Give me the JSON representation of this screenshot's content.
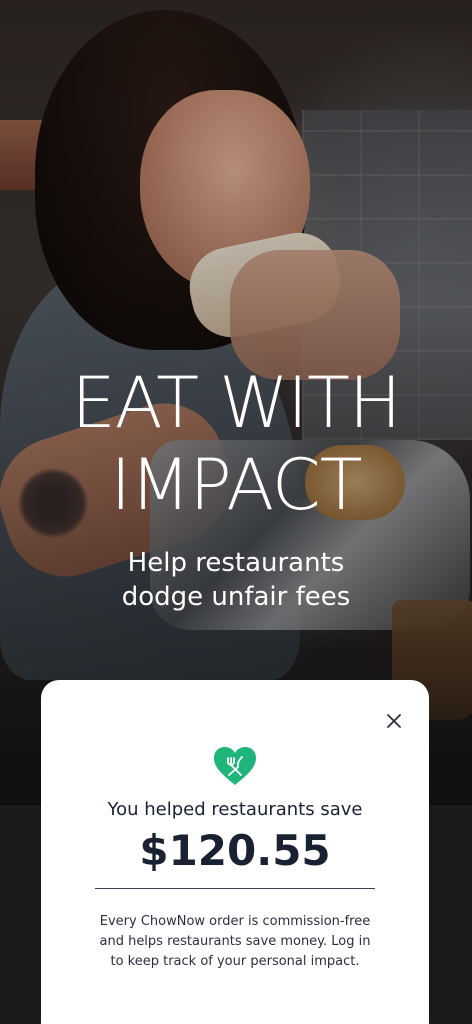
{
  "hero": {
    "headline_line1": "EAT WITH",
    "headline_line2": "IMPACT",
    "subhead_line1": "Help restaurants",
    "subhead_line2": "dodge unfair fees",
    "image": "woman-eating-sandwich-photo"
  },
  "impact_card": {
    "close_icon": "close-icon",
    "heart_icon": "heart-fork-knife-icon",
    "title": "You helped restaurants save",
    "amount": "$120.55",
    "description_line1": "Every ChowNow order is commission-free",
    "description_line2": "and helps restaurants save money. Log in",
    "description_line3": "to keep track of your personal impact."
  },
  "colors": {
    "accent_green": "#1fb57a",
    "text_dark": "#1a2133",
    "card_bg": "#ffffff",
    "bottom_bg": "#1b1b1b"
  }
}
